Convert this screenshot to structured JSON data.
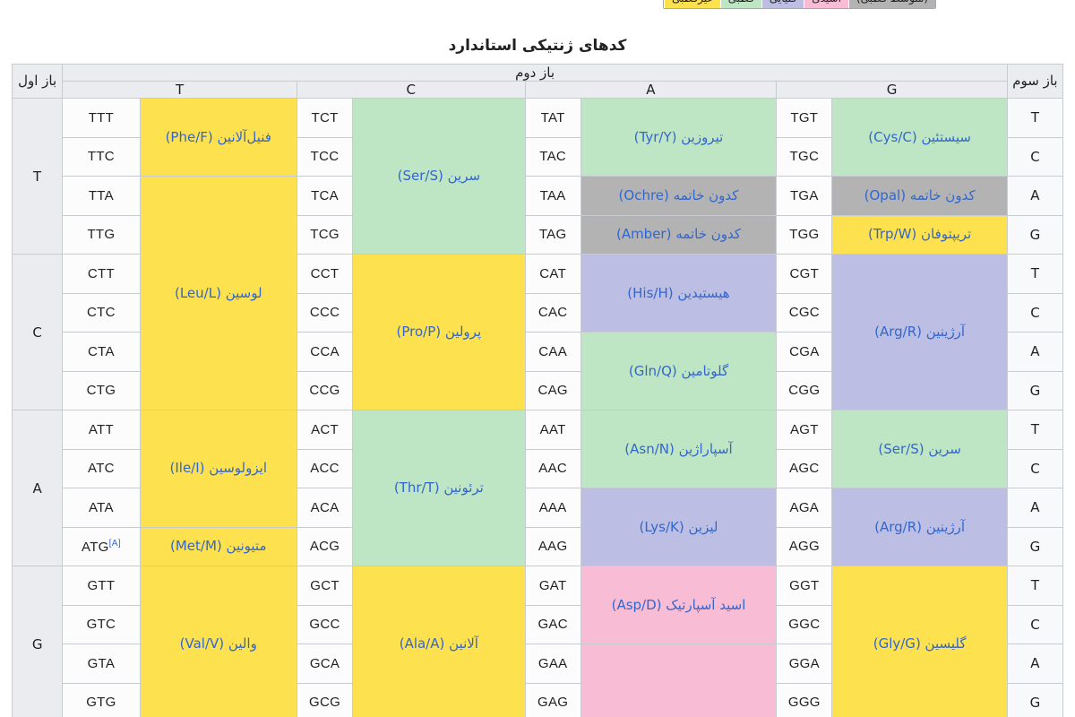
{
  "legend": {
    "items": [
      {
        "label": "(متوسط قطبی)",
        "color": "#b3b3b3"
      },
      {
        "label": "اسیدی",
        "color": "#f9bcd5"
      },
      {
        "label": "قلیایی",
        "color": "#bcbfe3"
      },
      {
        "label": "قطبی",
        "color": "#bfe6c4"
      },
      {
        "label": "غیرقطبی",
        "color": "#fde14f"
      }
    ]
  },
  "title": "کدهای ژنتیکی استاندارد",
  "headers": {
    "third_base": "باز سوم",
    "second_base": "باز دوم",
    "first_base": "باز اول",
    "second_base_cols": [
      "G",
      "A",
      "C",
      "T"
    ]
  },
  "colors": {
    "nonpolar": "#fde14f",
    "polar": "#bfe6c4",
    "basic": "#bcbfe3",
    "acidic": "#f9bcd5",
    "stop": "#b3b3b3",
    "header_bg": "#eaecf0",
    "link": "#3366cc",
    "border": "#c8ccd1"
  },
  "amino_acids": {
    "phe": "فنیل‌آلانین (Phe/F)",
    "leu": "لوسین (Leu/L)",
    "ser": "سرین (Ser/S)",
    "tyr": "تیروزین (Tyr/Y)",
    "cys": "سیستئین (Cys/C)",
    "trp": "تریپتوفان (Trp/W)",
    "pro": "پرولین (Pro/P)",
    "his": "هیستیدین (His/H)",
    "gln": "گلوتامین (Gln/Q)",
    "arg": "آرژینین (Arg/R)",
    "ile": "ایزولوسین (Ile/I)",
    "met": "متیونین (Met/M)",
    "thr": "ترئونین (Thr/T)",
    "asn": "آسپاراژین (Asn/N)",
    "lys": "لیزین (Lys/K)",
    "val": "والین (Val/V)",
    "ala": "آلانین (Ala/A)",
    "asp": "اسید آسپارتیک (Asp/D)",
    "gly": "گلیسین (Gly/G)",
    "stop_ochre": "کدون خاتمه (Ochre)",
    "stop_amber": "کدون خاتمه (Amber)",
    "stop_opal": "کدون خاتمه (Opal)",
    "stop_prefix": "کدون خاتمه"
  },
  "third_bases": [
    "T",
    "C",
    "A",
    "G"
  ],
  "first_bases": [
    "T",
    "C",
    "A",
    "G"
  ],
  "codons": {
    "b1": {
      "G": [
        "TGT",
        "TGC",
        "TGA",
        "TGG"
      ],
      "A": [
        "TAT",
        "TAC",
        "TAA",
        "TAG"
      ],
      "C": [
        "TCT",
        "TCC",
        "TCA",
        "TCG"
      ],
      "T": [
        "TTT",
        "TTC",
        "TTA",
        "TTG"
      ]
    },
    "b2": {
      "G": [
        "CGT",
        "CGC",
        "CGA",
        "CGG"
      ],
      "A": [
        "CAT",
        "CAC",
        "CAA",
        "CAG"
      ],
      "C": [
        "CCT",
        "CCC",
        "CCA",
        "CCG"
      ],
      "T": [
        "CTT",
        "CTC",
        "CTA",
        "CTG"
      ]
    },
    "b3": {
      "G": [
        "AGT",
        "AGC",
        "AGA",
        "AGG"
      ],
      "A": [
        "AAT",
        "AAC",
        "AAA",
        "AAG"
      ],
      "C": [
        "ACT",
        "ACC",
        "ACA",
        "ACG"
      ],
      "T": [
        "ATT",
        "ATC",
        "ATA",
        "ATG"
      ]
    },
    "b4": {
      "G": [
        "GGT",
        "GGC",
        "GGA",
        "GGG"
      ],
      "A": [
        "GAT",
        "GAC",
        "GAA",
        "GAG"
      ],
      "C": [
        "GCT",
        "GCC",
        "GCA",
        "GCG"
      ],
      "T": [
        "GTT",
        "GTC",
        "GTA",
        "GTG"
      ]
    }
  },
  "notes": {
    "met_ref": "[A]"
  }
}
